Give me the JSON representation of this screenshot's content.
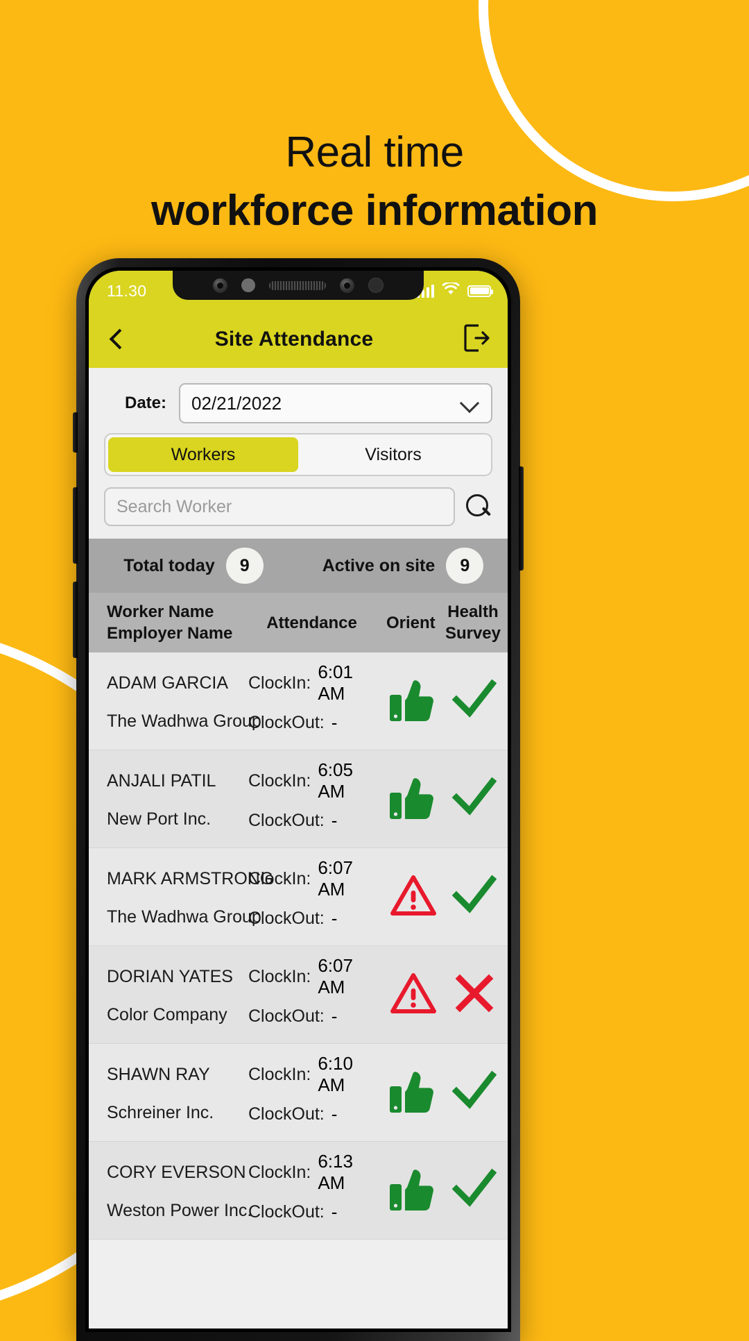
{
  "promo": {
    "line1": "Real time",
    "line2": "workforce information",
    "bg_color": "#fdb913",
    "arc_color": "#ffffff"
  },
  "phone": {
    "statusbar": {
      "time": "11.30",
      "icons": [
        "signal-bars-icon",
        "wifi-icon",
        "battery-icon"
      ]
    },
    "appbar": {
      "back_icon": "chevron-left-icon",
      "title": "Site Attendance",
      "logout_icon": "logout-icon",
      "bar_color": "#d9d520"
    },
    "date_row": {
      "label": "Date:",
      "value": "02/21/2022",
      "dropdown_icon": "chevron-down-icon"
    },
    "tabs": [
      {
        "label": "Workers",
        "active": true
      },
      {
        "label": "Visitors",
        "active": false
      }
    ],
    "search": {
      "placeholder": "Search Worker",
      "value": "",
      "icon": "search-icon"
    },
    "stats": [
      {
        "label": "Total today",
        "count": "9"
      },
      {
        "label": "Active on site",
        "count": "9"
      }
    ],
    "table": {
      "headers": {
        "name_line1": "Worker Name",
        "name_line2": "Employer Name",
        "attendance": "Attendance",
        "orient": "Orient",
        "health_line1": "Health",
        "health_line2": "Survey"
      },
      "labels": {
        "clockin": "ClockIn:",
        "clockout": "ClockOut:"
      },
      "rows": [
        {
          "worker": "ADAM GARCIA",
          "employer": "The Wadhwa Group",
          "clockin": "6:01 AM",
          "clockout": "-",
          "orient": "thumbs-up-icon",
          "health": "check-icon"
        },
        {
          "worker": "ANJALI PATIL",
          "employer": "New Port Inc.",
          "clockin": "6:05 AM",
          "clockout": "-",
          "orient": "thumbs-up-icon",
          "health": "check-icon"
        },
        {
          "worker": "MARK ARMSTRONG",
          "employer": "The Wadhwa Group",
          "clockin": "6:07 AM",
          "clockout": "-",
          "orient": "warning-icon",
          "health": "check-icon"
        },
        {
          "worker": "DORIAN YATES",
          "employer": "Color Company",
          "clockin": "6:07 AM",
          "clockout": "-",
          "orient": "warning-icon",
          "health": "cross-icon"
        },
        {
          "worker": "SHAWN RAY",
          "employer": "Schreiner Inc.",
          "clockin": "6:10 AM",
          "clockout": "-",
          "orient": "thumbs-up-icon",
          "health": "check-icon"
        },
        {
          "worker": "CORY EVERSON",
          "employer": "Weston Power Inc.",
          "clockin": "6:13 AM",
          "clockout": "-",
          "orient": "thumbs-up-icon",
          "health": "check-icon"
        }
      ]
    },
    "colors": {
      "ok_green": "#1a8a2e",
      "alert_red": "#e8192c",
      "accent_yellow": "#d9d520"
    }
  }
}
